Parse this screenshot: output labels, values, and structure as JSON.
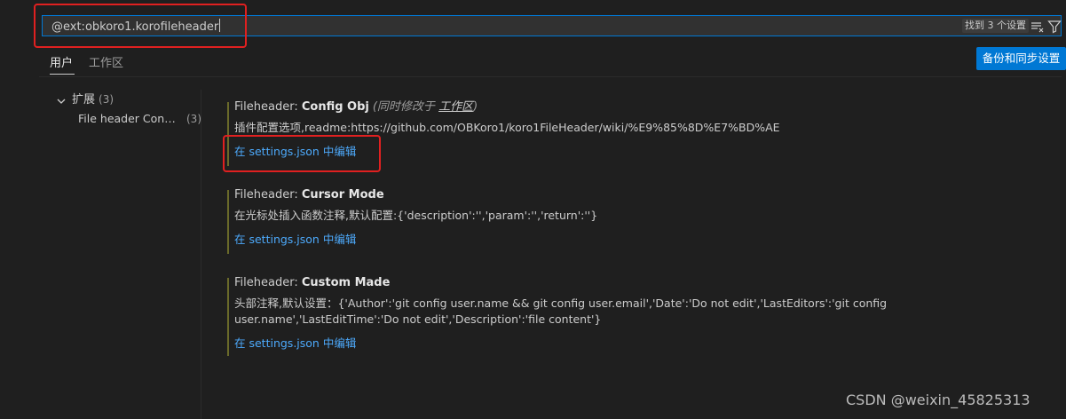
{
  "search": {
    "value": "@ext:obkoro1.korofileheader",
    "result_badge": "找到 3 个设置"
  },
  "icons": {
    "clear_filters": "clear-filter-icon",
    "filter": "filter-icon",
    "toc_chevron": "chevron-down-icon"
  },
  "tabs": [
    {
      "label": "用户",
      "active": true
    },
    {
      "label": "工作区",
      "active": false
    }
  ],
  "backup_button": "备份和同步设置",
  "toc": {
    "group_label": "扩展",
    "group_count": "(3)",
    "child_label": "File header Config...",
    "child_count": "(3)"
  },
  "settings": [
    {
      "prefix": "Fileheader: ",
      "name": "Config Obj",
      "scope_prefix": "(同时修改于",
      "scope_link": "工作区",
      "scope_suffix": ")",
      "description": "插件配置选项,readme:https://github.com/OBKoro1/koro1FileHeader/wiki/%E9%85%8D%E7%BD%AE",
      "link": "在 settings.json 中编辑"
    },
    {
      "prefix": "Fileheader: ",
      "name": "Cursor Mode",
      "description": "在光标处插入函数注释,默认配置:{'description':'','param':'','return':''}",
      "link": "在 settings.json 中编辑"
    },
    {
      "prefix": "Fileheader: ",
      "name": "Custom Made",
      "description": "头部注释,默认设置：{'Author':'git config user.name && git config user.email','Date':'Do not edit','LastEditors':'git config user.name','LastEditTime':'Do not edit','Description':'file content'}",
      "link": "在 settings.json 中编辑"
    }
  ],
  "watermark": "CSDN @weixin_45825313",
  "colors": {
    "background": "#1f1f1f",
    "accent": "#0078d4",
    "link": "#4daafc",
    "highlight_box": "#e02020"
  }
}
